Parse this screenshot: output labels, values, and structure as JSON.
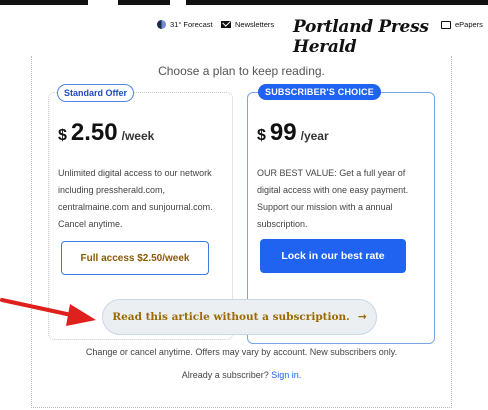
{
  "header": {
    "weather": "31° Forecast",
    "newsletters": "Newsletters",
    "masthead": "Portland Press Herald",
    "epapers": "ePapers"
  },
  "main": {
    "heading": "Choose a plan to keep reading.",
    "plans": [
      {
        "badge": "Standard Offer",
        "currency": "$",
        "amount": "2.50",
        "period": "/week",
        "description": "Unlimited digital access to our network including pressherald.com, centralmaine.com and sunjournal.com. Cancel anytime.",
        "cta": "Full access $2.50/week"
      },
      {
        "badge": "SUBSCRIBER'S CHOICE",
        "currency": "$",
        "amount": "99",
        "period": "/year",
        "description": "OUR BEST VALUE: Get a full year of digital access with one easy payment. Support our mission with a annual subscription.",
        "cta": "Lock in our best rate"
      }
    ],
    "read_without": "Read this article without a subscription.",
    "read_arrow": "→",
    "note": "Change or cancel anytime. Offers may vary by account. New subscribers only.",
    "signin_prefix": "Already a subscriber?",
    "signin_link": "Sign in."
  },
  "colors": {
    "accent": "#1f63f0",
    "cta_text": "#9a6a00",
    "annotation": "#e0201c"
  }
}
